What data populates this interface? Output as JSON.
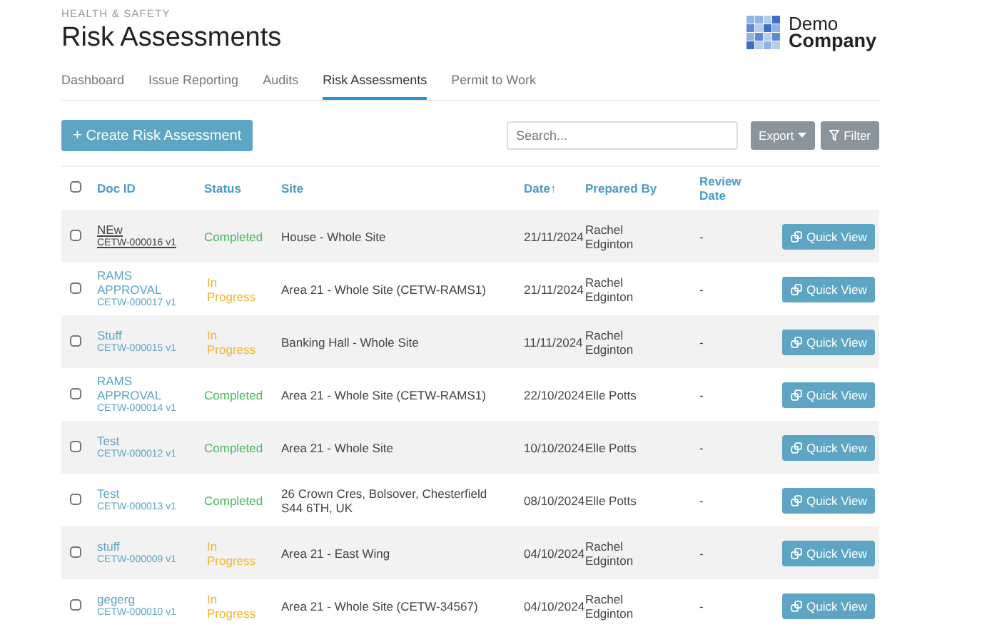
{
  "header": {
    "section": "HEALTH & SAFETY",
    "title": "Risk Assessments",
    "logo": {
      "line_1": "Demo",
      "line_2": "Company"
    }
  },
  "tabs": [
    {
      "label": "Dashboard",
      "selected": false
    },
    {
      "label": "Issue Reporting",
      "selected": false
    },
    {
      "label": "Audits",
      "selected": false
    },
    {
      "label": "Risk Assessments",
      "selected": true
    },
    {
      "label": "Permit to Work",
      "selected": false
    }
  ],
  "toolbar": {
    "create_button": {
      "icon": "+",
      "label": "Create Risk Assessment"
    },
    "search": {
      "placeholder": "Search..."
    },
    "export_button": "Export",
    "filter_button": "Filter"
  },
  "table": {
    "select_all": {
      "checked": false
    },
    "columns": [
      {
        "label": "Doc ID"
      },
      {
        "label": "Status"
      },
      {
        "label": "Site"
      },
      {
        "label": "Date",
        "sort": "↑"
      },
      {
        "label": "Prepared By"
      },
      {
        "label": "Review Date"
      }
    ],
    "rows": [
      {
        "checked": false,
        "title": "NEw",
        "doc_id": "CETW-000016 v1",
        "visited": true,
        "status": {
          "label": "Completed",
          "kind": "completed"
        },
        "site": "House - Whole Site",
        "date": "21/11/2024",
        "prepared_by": "Rachel Edginton",
        "review_date": "-",
        "action": "Quick View"
      },
      {
        "checked": false,
        "title": "RAMS APPROVAL",
        "doc_id": "CETW-000017 v1",
        "visited": false,
        "status": {
          "label": "In Progress",
          "kind": "in_progress"
        },
        "site": "Area 21 - Whole Site (CETW-RAMS1)",
        "date": "21/11/2024",
        "prepared_by": "Rachel Edginton",
        "review_date": "-",
        "action": "Quick View"
      },
      {
        "checked": false,
        "title": "Stuff",
        "doc_id": "CETW-000015 v1",
        "visited": false,
        "status": {
          "label": "In Progress",
          "kind": "in_progress"
        },
        "site": "Banking Hall - Whole Site",
        "date": "11/11/2024",
        "prepared_by": "Rachel Edginton",
        "review_date": "-",
        "action": "Quick View"
      },
      {
        "checked": false,
        "title": "RAMS APPROVAL",
        "doc_id": "CETW-000014 v1",
        "visited": false,
        "status": {
          "label": "Completed",
          "kind": "completed"
        },
        "site": "Area 21 - Whole Site (CETW-RAMS1)",
        "date": "22/10/2024",
        "prepared_by": "Elle Potts",
        "review_date": "-",
        "action": "Quick View"
      },
      {
        "checked": false,
        "title": "Test",
        "doc_id": "CETW-000012 v1",
        "visited": false,
        "status": {
          "label": "Completed",
          "kind": "completed"
        },
        "site": "Area 21 - Whole Site",
        "date": "10/10/2024",
        "prepared_by": "Elle Potts",
        "review_date": "-",
        "action": "Quick View"
      },
      {
        "checked": false,
        "title": "Test",
        "doc_id": "CETW-000013 v1",
        "visited": false,
        "status": {
          "label": "Completed",
          "kind": "completed"
        },
        "site": "26 Crown Cres, Bolsover, Chesterfield S44 6TH, UK",
        "date": "08/10/2024",
        "prepared_by": "Elle Potts",
        "review_date": "-",
        "action": "Quick View"
      },
      {
        "checked": false,
        "title": "stuff",
        "doc_id": "CETW-000009 v1",
        "visited": false,
        "status": {
          "label": "In Progress",
          "kind": "in_progress"
        },
        "site": "Area 21 - East Wing",
        "date": "04/10/2024",
        "prepared_by": "Rachel Edginton",
        "review_date": "-",
        "action": "Quick View"
      },
      {
        "checked": false,
        "title": "gegerg",
        "doc_id": "CETW-000010 v1",
        "visited": false,
        "status": {
          "label": "In Progress",
          "kind": "in_progress"
        },
        "site": "Area 21 - Whole Site (CETW-34567)",
        "date": "04/10/2024",
        "prepared_by": "Rachel Edginton",
        "review_date": "-",
        "action": "Quick View"
      }
    ]
  }
}
